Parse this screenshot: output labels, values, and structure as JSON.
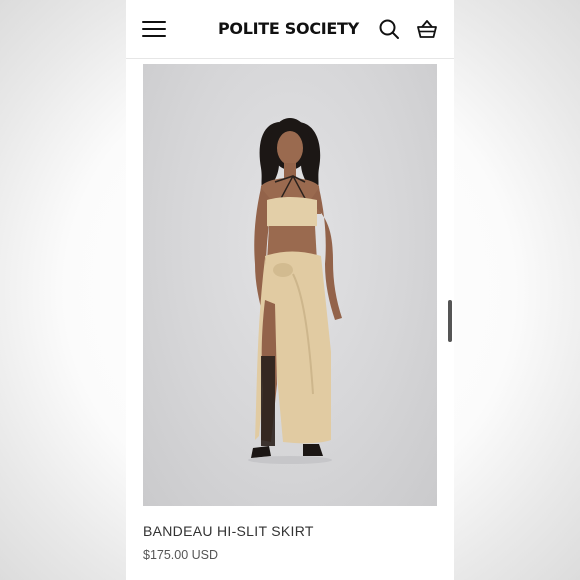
{
  "header": {
    "brand": "POLITE SOCIETY",
    "menu_icon": "hamburger-menu-icon",
    "search_icon": "search-icon",
    "cart_icon": "shopping-basket-icon"
  },
  "product": {
    "title": "BANDEAU HI-SLIT SKIRT",
    "price": "$175.00 USD"
  },
  "colors": {
    "background": "#ffffff",
    "text": "#111111",
    "image_backdrop": "#d6d6d8",
    "garment": "#e3cfa8"
  }
}
